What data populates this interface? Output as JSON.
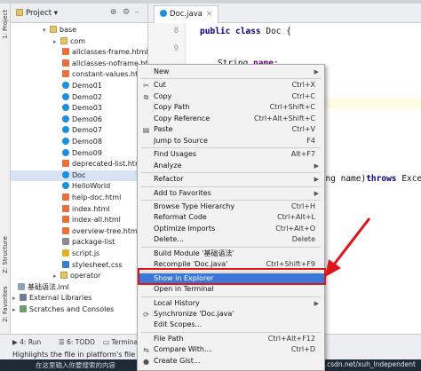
{
  "left_strip": {
    "project_tab": "1: Project",
    "structure_tab": "Z: Structure",
    "favorites_tab": "2: Favorites"
  },
  "project_panel": {
    "title": "Project",
    "tree": [
      {
        "label": "base",
        "icon": "folder-icon",
        "expand": "down",
        "selected": false
      },
      {
        "label": "com",
        "icon": "folder-icon",
        "expand": "right",
        "selected": false
      },
      {
        "label": "allclasses-frame.html",
        "icon": "html-icon",
        "selected": false
      },
      {
        "label": "allclasses-noframe.html",
        "icon": "html-icon",
        "selected": false
      },
      {
        "label": "constant-values.html",
        "icon": "html-icon",
        "selected": false
      },
      {
        "label": "Demo01",
        "icon": "class-icon",
        "selected": false
      },
      {
        "label": "Demo02",
        "icon": "class-icon",
        "selected": false
      },
      {
        "label": "Demo03",
        "icon": "class-icon",
        "selected": false
      },
      {
        "label": "Demo06",
        "icon": "class-icon",
        "selected": false
      },
      {
        "label": "Demo07",
        "icon": "class-icon",
        "selected": false
      },
      {
        "label": "Demo08",
        "icon": "class-icon",
        "selected": false
      },
      {
        "label": "Demo09",
        "icon": "class-icon",
        "selected": false
      },
      {
        "label": "deprecated-list.html",
        "icon": "html-icon",
        "selected": false
      },
      {
        "label": "Doc",
        "icon": "class-icon",
        "selected": true
      },
      {
        "label": "HelloWorld",
        "icon": "class-icon",
        "selected": false
      },
      {
        "label": "help-doc.html",
        "icon": "html-icon",
        "selected": false
      },
      {
        "label": "index.html",
        "icon": "html-icon",
        "selected": false
      },
      {
        "label": "index-all.html",
        "icon": "html-icon",
        "selected": false
      },
      {
        "label": "overview-tree.html",
        "icon": "html-icon",
        "selected": false
      },
      {
        "label": "package-list",
        "icon": "file-icon",
        "selected": false
      },
      {
        "label": "script.js",
        "icon": "js-icon",
        "selected": false
      },
      {
        "label": "stylesheet.css",
        "icon": "css-icon",
        "selected": false
      },
      {
        "label": "operator",
        "icon": "folder-icon",
        "expand": "right",
        "selected": false
      },
      {
        "label": "基础语法.iml",
        "icon": "iml-icon",
        "selected": false
      },
      {
        "label": "External Libraries",
        "icon": "library-icon",
        "expand": "right",
        "selected": false
      },
      {
        "label": "Scratches and Consoles",
        "icon": "scratch-icon",
        "expand": "right",
        "selected": false
      }
    ]
  },
  "editor": {
    "tab_label": "Doc.java",
    "line_numbers": [
      "8",
      "9"
    ],
    "lines": [
      {
        "kw": "public class",
        "rest": " Doc {"
      },
      {
        "plain": "String ",
        "field": "name",
        "tail": ";"
      }
    ],
    "partial_signature": {
      "text": "ring name)",
      "kw": "throws",
      "tail": " Exce"
    }
  },
  "context_menu": {
    "items": [
      {
        "label": "New",
        "shortcut": "",
        "submenu": true,
        "icon": ""
      },
      {
        "sep": true
      },
      {
        "label": "Cut",
        "shortcut": "Ctrl+X",
        "icon": "scissors-icon"
      },
      {
        "label": "Copy",
        "shortcut": "Ctrl+C",
        "icon": "copy-icon"
      },
      {
        "label": "Copy Path",
        "shortcut": "Ctrl+Shift+C",
        "icon": ""
      },
      {
        "label": "Copy Reference",
        "shortcut": "Ctrl+Alt+Shift+C",
        "icon": ""
      },
      {
        "label": "Paste",
        "shortcut": "Ctrl+V",
        "icon": "paste-icon"
      },
      {
        "label": "Jump to Source",
        "shortcut": "F4",
        "icon": ""
      },
      {
        "sep": true
      },
      {
        "label": "Find Usages",
        "shortcut": "Alt+F7",
        "icon": ""
      },
      {
        "label": "Analyze",
        "shortcut": "",
        "submenu": true,
        "icon": ""
      },
      {
        "sep": true
      },
      {
        "label": "Refactor",
        "shortcut": "",
        "submenu": true,
        "icon": ""
      },
      {
        "sep": true
      },
      {
        "label": "Add to Favorites",
        "shortcut": "",
        "submenu": true,
        "icon": ""
      },
      {
        "sep": true
      },
      {
        "label": "Browse Type Hierarchy",
        "shortcut": "Ctrl+H",
        "icon": ""
      },
      {
        "label": "Reformat Code",
        "shortcut": "Ctrl+Alt+L",
        "icon": ""
      },
      {
        "label": "Optimize Imports",
        "shortcut": "Ctrl+Alt+O",
        "icon": ""
      },
      {
        "label": "Delete...",
        "shortcut": "Delete",
        "icon": ""
      },
      {
        "sep": true
      },
      {
        "label": "Build Module '基础语法'",
        "shortcut": "",
        "icon": ""
      },
      {
        "label": "Recompile 'Doc.java'",
        "shortcut": "Ctrl+Shift+F9",
        "icon": ""
      },
      {
        "sep": true
      },
      {
        "label": "Show in Explorer",
        "shortcut": "",
        "icon": "",
        "active": true
      },
      {
        "label": "Open in Terminal",
        "shortcut": "",
        "icon": ""
      },
      {
        "sep": true
      },
      {
        "label": "Local History",
        "shortcut": "",
        "submenu": true,
        "icon": ""
      },
      {
        "label": "Synchronize 'Doc.java'",
        "shortcut": "",
        "icon": "sync-icon"
      },
      {
        "label": "Edit Scopes...",
        "shortcut": "",
        "icon": ""
      },
      {
        "sep": true
      },
      {
        "label": "File Path",
        "shortcut": "Ctrl+Alt+F12",
        "icon": ""
      },
      {
        "label": "Compare With...",
        "shortcut": "Ctrl+D",
        "icon": "compare-icon"
      },
      {
        "label": "Create Gist...",
        "shortcut": "",
        "icon": "github-icon"
      }
    ]
  },
  "status_bar": {
    "run_label": "4: Run",
    "todo_label": "6: TODO",
    "terminal_label": "Terminal",
    "message": "Highlights the file in platform's file man"
  },
  "taskbar": {
    "search_text": "在这里输入你要搜索的内容"
  },
  "watermark": "https://blog.csdn.net/xuh_lndependent",
  "colors": {
    "menu_highlight": "#3a77d7",
    "annotation_red": "#e0141b",
    "tree_selection": "#d5e3f3"
  }
}
